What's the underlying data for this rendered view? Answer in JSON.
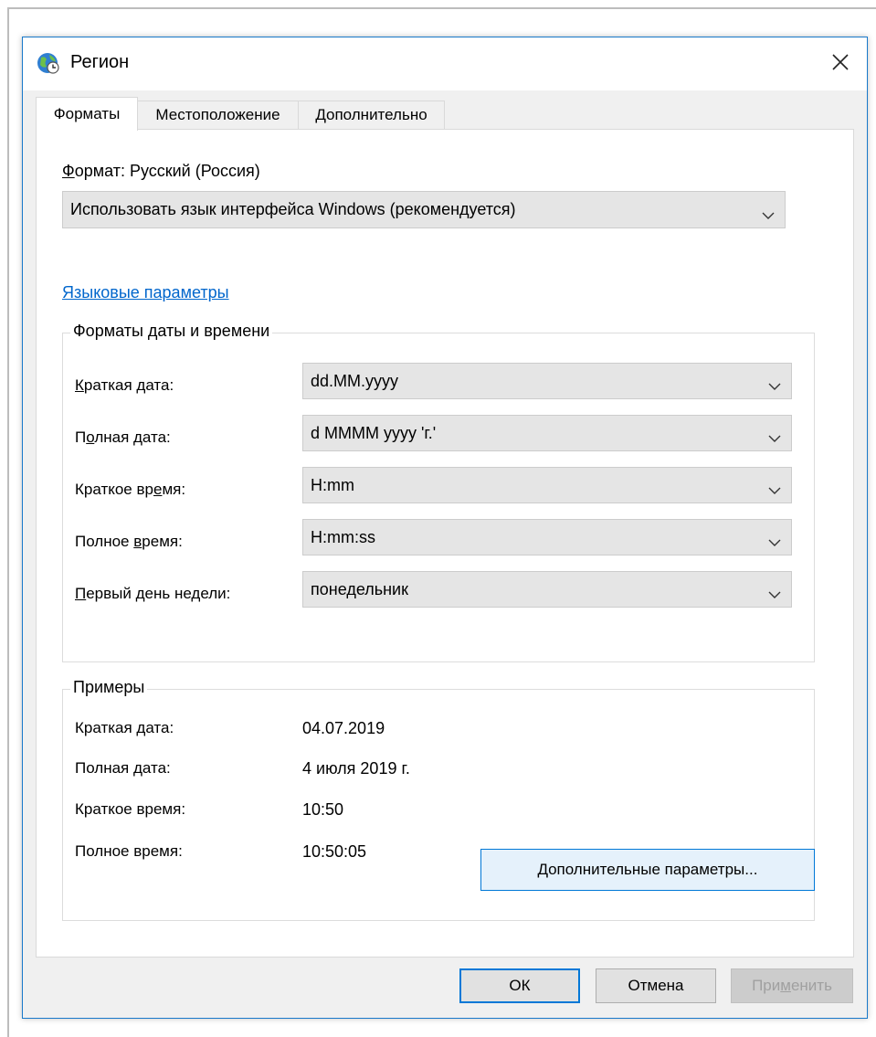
{
  "window": {
    "title": "Регион",
    "icon": "globe-clock-icon",
    "close_icon": "close-icon"
  },
  "tabs": [
    {
      "label": "Форматы",
      "active": true
    },
    {
      "label": "Местоположение",
      "active": false
    },
    {
      "label": "Дополнительно",
      "active": false
    }
  ],
  "format": {
    "label_prefix": "Ф",
    "label_rest": "ормат: Русский (Россия)",
    "selected": "Использовать язык интерфейса Windows (рекомендуется)"
  },
  "language_link": "Языковые параметры",
  "datetime_group": {
    "title": "Форматы даты и времени",
    "rows": [
      {
        "pre": "",
        "u": "К",
        "post": "раткая дата:",
        "value": "dd.MM.yyyy"
      },
      {
        "pre": "П",
        "u": "о",
        "post": "лная дата:",
        "value": "d MMMM yyyy 'г.'"
      },
      {
        "pre": "Краткое вр",
        "u": "е",
        "post": "мя:",
        "value": "H:mm"
      },
      {
        "pre": "Полное ",
        "u": "в",
        "post": "ремя:",
        "value": "H:mm:ss"
      },
      {
        "pre": "",
        "u": "П",
        "post": "ервый день недели:",
        "value": "понедельник"
      }
    ]
  },
  "examples_group": {
    "title": "Примеры",
    "rows": [
      {
        "label": "Краткая дата:",
        "value": "04.07.2019"
      },
      {
        "label": "Полная дата:",
        "value": "4 июля 2019 г."
      },
      {
        "label": "Краткое время:",
        "value": "10:50"
      },
      {
        "label": "Полное время:",
        "value": "10:50:05"
      }
    ]
  },
  "advanced_button": {
    "u": "Д",
    "rest": "ополнительные параметры..."
  },
  "buttons": {
    "ok": "ОК",
    "cancel": "Отмена",
    "apply_pre": "При",
    "apply_u": "м",
    "apply_post": "енить"
  },
  "colors": {
    "accent": "#0078d7",
    "link": "#0066cc",
    "window_border": "#1979ca"
  }
}
